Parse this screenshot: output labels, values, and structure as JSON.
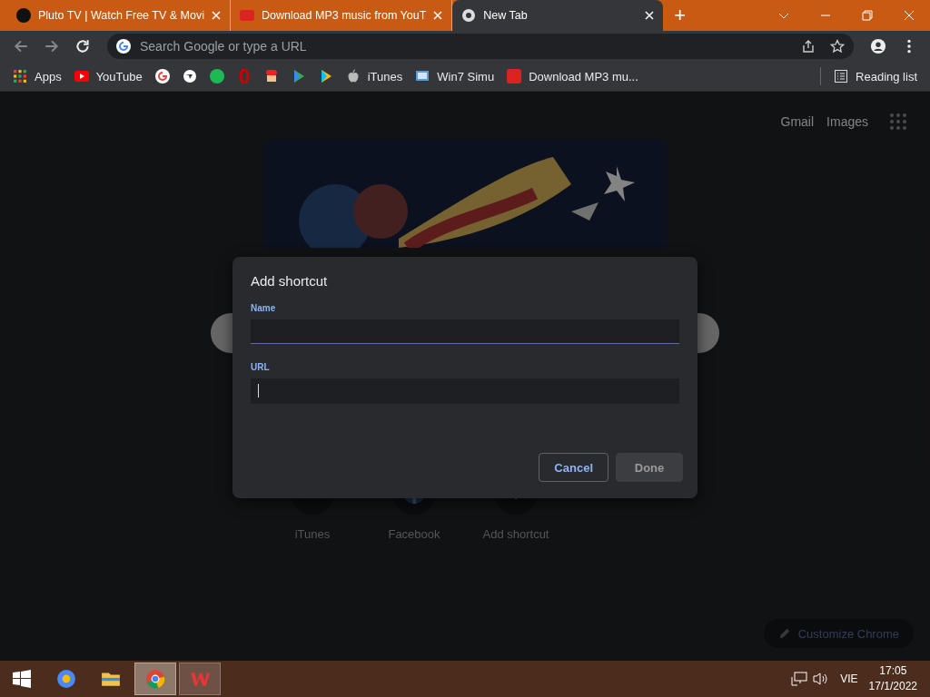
{
  "tabs": [
    {
      "title": "Pluto TV | Watch Free TV & Movi",
      "selected": false
    },
    {
      "title": "Download MP3 music from YouT",
      "selected": false
    },
    {
      "title": "New Tab",
      "selected": true
    }
  ],
  "new_tab_button": "+",
  "address_bar": {
    "placeholder": "Search Google or type a URL"
  },
  "bookmarks_left": [
    "Apps",
    "YouTube"
  ],
  "bookmarks_right": [
    "iTunes",
    "Win7 Simu",
    "Download MP3 mu..."
  ],
  "reading_list": "Reading list",
  "header_links": [
    "Gmail",
    "Images"
  ],
  "shortcuts": [
    {
      "kind": "site",
      "label": "iTunes"
    },
    {
      "kind": "site",
      "label": "Facebook"
    },
    {
      "kind": "add",
      "label": "Add shortcut"
    }
  ],
  "customize_button": "Customize Chrome",
  "dialog": {
    "title": "Add shortcut",
    "fields": [
      {
        "label": "Name",
        "focused": false
      },
      {
        "label": "URL",
        "focused": true
      }
    ],
    "buttons": [
      {
        "label": "Cancel",
        "disabled": false
      },
      {
        "label": "Done",
        "disabled": true
      }
    ]
  },
  "taskbar": {
    "language": "VIE",
    "time": "17:05",
    "date": "17/1/2022"
  }
}
